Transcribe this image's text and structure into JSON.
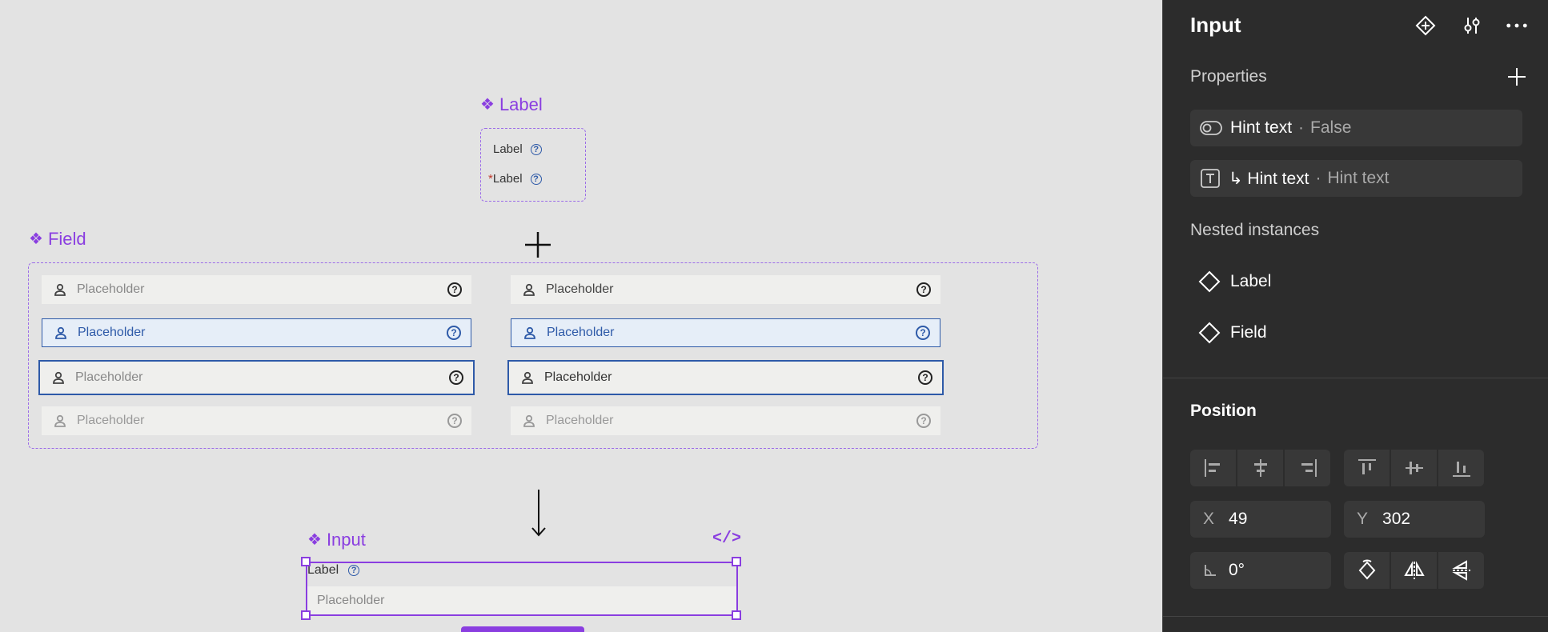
{
  "canvas": {
    "label_component": {
      "title": "Label",
      "rows": [
        {
          "required": "",
          "text": "Label"
        },
        {
          "required": "*",
          "text": "Label"
        }
      ]
    },
    "field_component": {
      "title": "Field",
      "placeholder": "Placeholder",
      "states": [
        "default",
        "hover",
        "focus",
        "disabled"
      ]
    },
    "input_component": {
      "title": "Input",
      "code_icon": "</>",
      "label": "Label",
      "placeholder": "Placeholder"
    },
    "accent_color": "#8a3ee0",
    "field_border_color": "#2e5aa8"
  },
  "panel": {
    "title": "Input",
    "properties_label": "Properties",
    "properties": [
      {
        "icon": "toggle-icon",
        "name": "Hint text",
        "sep": "·",
        "value": "False"
      },
      {
        "icon": "text-icon",
        "name": "↳ Hint text",
        "sep": "·",
        "value": "Hint text"
      }
    ],
    "nested_label": "Nested instances",
    "nested": [
      "Label",
      "Field"
    ],
    "position_label": "Position",
    "x_label": "X",
    "x_value": "49",
    "y_label": "Y",
    "y_value": "302",
    "rotation_value": "0°"
  }
}
